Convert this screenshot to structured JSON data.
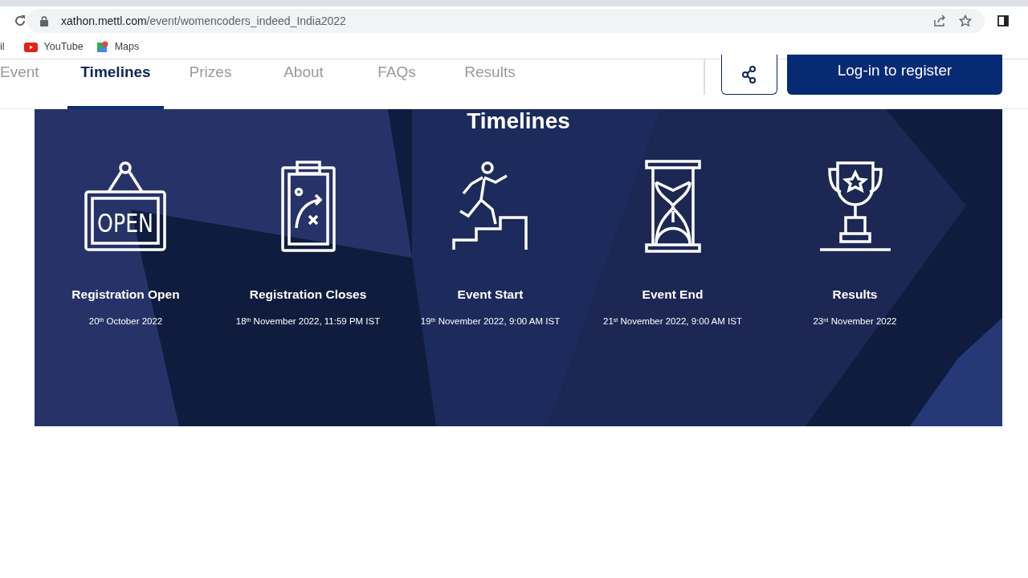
{
  "browser": {
    "url_host": "xathon.mettl.com",
    "url_path": "/event/womencoders_indeed_India2022"
  },
  "bookmarks": [
    {
      "label": "il",
      "kind": "cut"
    },
    {
      "label": "YouTube",
      "kind": "youtube"
    },
    {
      "label": "Maps",
      "kind": "maps"
    }
  ],
  "tabs": [
    {
      "label": "Event",
      "selected": false
    },
    {
      "label": "Timelines",
      "selected": true
    },
    {
      "label": "Prizes",
      "selected": false
    },
    {
      "label": "About",
      "selected": false
    },
    {
      "label": "FAQs",
      "selected": false
    },
    {
      "label": "Results",
      "selected": false
    }
  ],
  "register_button": "Log-in to register",
  "timeline": {
    "title": "Timelines",
    "items": [
      {
        "kind": "open-sign",
        "sign_text": "OPEN",
        "title": "Registration Open",
        "date": "20$^{th}$ October 2022"
      },
      {
        "kind": "clipboard",
        "title": "Registration Closes",
        "date": "18$^{th}$ November 2022, 11:59 PM IST"
      },
      {
        "kind": "runner",
        "title": "Event Start",
        "date": "19$^{th}$ November 2022, 9:00 AM IST"
      },
      {
        "kind": "hourglass",
        "title": "Event End",
        "date": "21$^{st}$ November 2022, 9:00 AM IST"
      },
      {
        "kind": "trophy",
        "title": "Results",
        "date": "23$^{rd}$ November 2022"
      }
    ]
  }
}
